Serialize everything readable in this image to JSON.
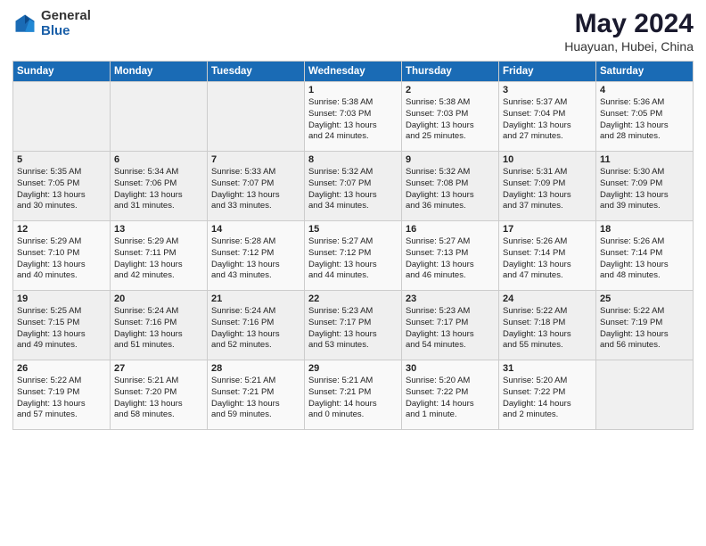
{
  "logo": {
    "general": "General",
    "blue": "Blue"
  },
  "header": {
    "title": "May 2024",
    "subtitle": "Huayuan, Hubei, China"
  },
  "weekdays": [
    "Sunday",
    "Monday",
    "Tuesday",
    "Wednesday",
    "Thursday",
    "Friday",
    "Saturday"
  ],
  "weeks": [
    [
      {
        "day": "",
        "text": ""
      },
      {
        "day": "",
        "text": ""
      },
      {
        "day": "",
        "text": ""
      },
      {
        "day": "1",
        "text": "Sunrise: 5:38 AM\nSunset: 7:03 PM\nDaylight: 13 hours\nand 24 minutes."
      },
      {
        "day": "2",
        "text": "Sunrise: 5:38 AM\nSunset: 7:03 PM\nDaylight: 13 hours\nand 25 minutes."
      },
      {
        "day": "3",
        "text": "Sunrise: 5:37 AM\nSunset: 7:04 PM\nDaylight: 13 hours\nand 27 minutes."
      },
      {
        "day": "4",
        "text": "Sunrise: 5:36 AM\nSunset: 7:05 PM\nDaylight: 13 hours\nand 28 minutes."
      }
    ],
    [
      {
        "day": "5",
        "text": "Sunrise: 5:35 AM\nSunset: 7:05 PM\nDaylight: 13 hours\nand 30 minutes."
      },
      {
        "day": "6",
        "text": "Sunrise: 5:34 AM\nSunset: 7:06 PM\nDaylight: 13 hours\nand 31 minutes."
      },
      {
        "day": "7",
        "text": "Sunrise: 5:33 AM\nSunset: 7:07 PM\nDaylight: 13 hours\nand 33 minutes."
      },
      {
        "day": "8",
        "text": "Sunrise: 5:32 AM\nSunset: 7:07 PM\nDaylight: 13 hours\nand 34 minutes."
      },
      {
        "day": "9",
        "text": "Sunrise: 5:32 AM\nSunset: 7:08 PM\nDaylight: 13 hours\nand 36 minutes."
      },
      {
        "day": "10",
        "text": "Sunrise: 5:31 AM\nSunset: 7:09 PM\nDaylight: 13 hours\nand 37 minutes."
      },
      {
        "day": "11",
        "text": "Sunrise: 5:30 AM\nSunset: 7:09 PM\nDaylight: 13 hours\nand 39 minutes."
      }
    ],
    [
      {
        "day": "12",
        "text": "Sunrise: 5:29 AM\nSunset: 7:10 PM\nDaylight: 13 hours\nand 40 minutes."
      },
      {
        "day": "13",
        "text": "Sunrise: 5:29 AM\nSunset: 7:11 PM\nDaylight: 13 hours\nand 42 minutes."
      },
      {
        "day": "14",
        "text": "Sunrise: 5:28 AM\nSunset: 7:12 PM\nDaylight: 13 hours\nand 43 minutes."
      },
      {
        "day": "15",
        "text": "Sunrise: 5:27 AM\nSunset: 7:12 PM\nDaylight: 13 hours\nand 44 minutes."
      },
      {
        "day": "16",
        "text": "Sunrise: 5:27 AM\nSunset: 7:13 PM\nDaylight: 13 hours\nand 46 minutes."
      },
      {
        "day": "17",
        "text": "Sunrise: 5:26 AM\nSunset: 7:14 PM\nDaylight: 13 hours\nand 47 minutes."
      },
      {
        "day": "18",
        "text": "Sunrise: 5:26 AM\nSunset: 7:14 PM\nDaylight: 13 hours\nand 48 minutes."
      }
    ],
    [
      {
        "day": "19",
        "text": "Sunrise: 5:25 AM\nSunset: 7:15 PM\nDaylight: 13 hours\nand 49 minutes."
      },
      {
        "day": "20",
        "text": "Sunrise: 5:24 AM\nSunset: 7:16 PM\nDaylight: 13 hours\nand 51 minutes."
      },
      {
        "day": "21",
        "text": "Sunrise: 5:24 AM\nSunset: 7:16 PM\nDaylight: 13 hours\nand 52 minutes."
      },
      {
        "day": "22",
        "text": "Sunrise: 5:23 AM\nSunset: 7:17 PM\nDaylight: 13 hours\nand 53 minutes."
      },
      {
        "day": "23",
        "text": "Sunrise: 5:23 AM\nSunset: 7:17 PM\nDaylight: 13 hours\nand 54 minutes."
      },
      {
        "day": "24",
        "text": "Sunrise: 5:22 AM\nSunset: 7:18 PM\nDaylight: 13 hours\nand 55 minutes."
      },
      {
        "day": "25",
        "text": "Sunrise: 5:22 AM\nSunset: 7:19 PM\nDaylight: 13 hours\nand 56 minutes."
      }
    ],
    [
      {
        "day": "26",
        "text": "Sunrise: 5:22 AM\nSunset: 7:19 PM\nDaylight: 13 hours\nand 57 minutes."
      },
      {
        "day": "27",
        "text": "Sunrise: 5:21 AM\nSunset: 7:20 PM\nDaylight: 13 hours\nand 58 minutes."
      },
      {
        "day": "28",
        "text": "Sunrise: 5:21 AM\nSunset: 7:21 PM\nDaylight: 13 hours\nand 59 minutes."
      },
      {
        "day": "29",
        "text": "Sunrise: 5:21 AM\nSunset: 7:21 PM\nDaylight: 14 hours\nand 0 minutes."
      },
      {
        "day": "30",
        "text": "Sunrise: 5:20 AM\nSunset: 7:22 PM\nDaylight: 14 hours\nand 1 minute."
      },
      {
        "day": "31",
        "text": "Sunrise: 5:20 AM\nSunset: 7:22 PM\nDaylight: 14 hours\nand 2 minutes."
      },
      {
        "day": "",
        "text": ""
      }
    ]
  ]
}
